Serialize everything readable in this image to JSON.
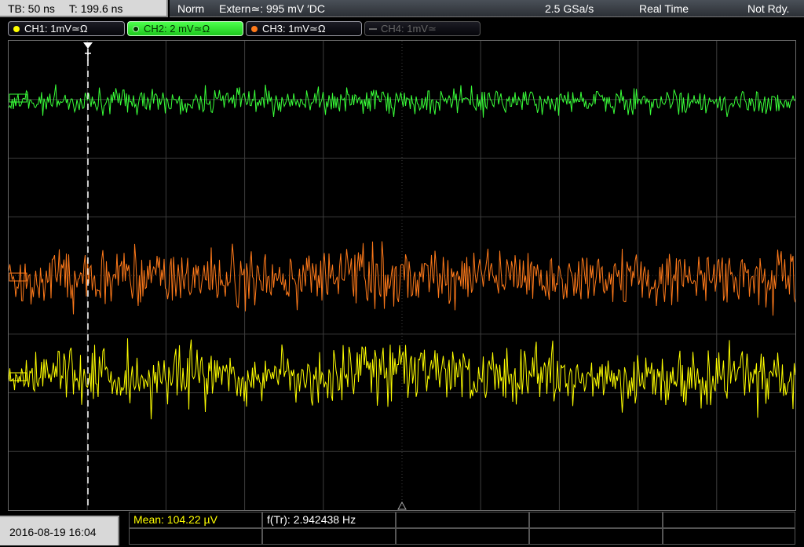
{
  "topbar": {
    "timebase": "TB: 50 ns",
    "trigger_time": "T: 199.6 ns",
    "mode": "Norm",
    "trigger": "Extern≃: 995 mV ′DC",
    "sample_rate": "2.5 GSa/s",
    "acq_mode": "Real Time",
    "status": "Not Rdy."
  },
  "channels": [
    {
      "label": "CH1: 1mV≃Ω",
      "color": "#ffff00",
      "active": false
    },
    {
      "label": "CH2: 2 mV≃Ω",
      "color": "#39ff39",
      "active": true
    },
    {
      "label": "CH3: 1mV≃Ω",
      "color": "#ff7a1a",
      "active": false
    },
    {
      "label": "CH4: 1mV≃",
      "color": "#666666",
      "active": false
    }
  ],
  "bottom": {
    "datetime": "2016-08-19 16:04",
    "mean_label": "Mean: 104.22 µV",
    "freq_label": "f(Tr): 2.942438 Hz"
  },
  "colors": {
    "grid": "#3c3c3c",
    "trace_ch1": "#ffff00",
    "trace_ch2": "#39ff39",
    "trace_ch3": "#ff7a1a",
    "mean_text": "#ffff00"
  }
}
